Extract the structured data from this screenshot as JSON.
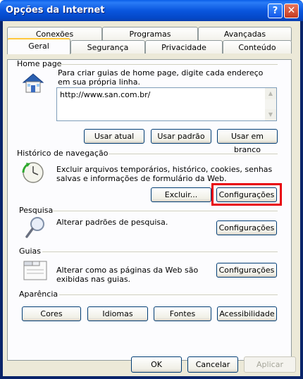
{
  "window": {
    "title": "Opções da Internet"
  },
  "tabs_back": [
    "Conexões",
    "Programas",
    "Avançadas"
  ],
  "tabs_front": [
    "Geral",
    "Segurança",
    "Privacidade",
    "Conteúdo"
  ],
  "home": {
    "title": "Home page",
    "description": "Para criar guias de home page, digite cada endereço em sua própria linha.",
    "url": "http://www.san.com.br/",
    "btn_current": "Usar atual",
    "btn_default": "Usar padrão",
    "btn_blank": "Usar em branco"
  },
  "history": {
    "title": "Histórico de navegação",
    "description": "Excluir arquivos temporários, histórico, cookies, senhas salvas e informações de formulário da Web.",
    "btn_delete": "Excluir...",
    "btn_settings": "Configurações"
  },
  "search": {
    "title": "Pesquisa",
    "description": "Alterar padrões de pesquisa.",
    "btn_settings": "Configurações"
  },
  "tabs_section": {
    "title": "Guias",
    "description": "Alterar como as páginas da Web são exibidas nas guias.",
    "btn_settings": "Configurações"
  },
  "appearance": {
    "title": "Aparência",
    "btn_colors": "Cores",
    "btn_languages": "Idiomas",
    "btn_fonts": "Fontes",
    "btn_accessibility": "Acessibilidade"
  },
  "footer": {
    "ok": "OK",
    "cancel": "Cancelar",
    "apply": "Aplicar"
  },
  "colors": {
    "highlight": "#e8000b",
    "titlebar": "#0a56de"
  }
}
